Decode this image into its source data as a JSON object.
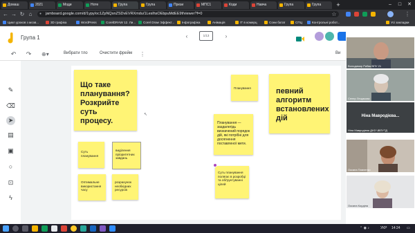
{
  "browser": {
    "tabs": [
      {
        "label": "Домаш",
        "color": "#f4b400"
      },
      {
        "label": "2021",
        "color": "#4285f4"
      },
      {
        "label": "Моди",
        "color": "#0f9d58"
      },
      {
        "label": "Ноте",
        "color": "#0f9d58"
      },
      {
        "label": "Група",
        "color": "#f4b400"
      },
      {
        "label": "Група",
        "color": "#f4b400"
      },
      {
        "label": "Прези",
        "color": "#4285f4"
      },
      {
        "label": "МПС1",
        "color": "#db4437"
      },
      {
        "label": "Коди",
        "color": "#db4437"
      },
      {
        "label": "Навча",
        "color": "#db4437"
      },
      {
        "label": "Група",
        "color": "#f4b400"
      },
      {
        "label": "Група",
        "color": "#f4b400"
      }
    ],
    "url": "jamboard.google.com/d/1ypy/oc1ZpNQsnZSDvEVRXmdu/1LeslhsOEbpuMdEE9f/viewer?f=0",
    "bookmarks": [
      {
        "label": "Цикл уроков з мозв...",
        "color": "#4285f4"
      },
      {
        "label": "3D графіка",
        "color": "#db4437"
      },
      {
        "label": "WordPress",
        "color": "#4285f4"
      },
      {
        "label": "CorelDRAW 12. Ли...",
        "color": "#0f9d58"
      },
      {
        "label": "Corel Draw Эффект...",
        "color": "#0f9d58"
      },
      {
        "label": "Інфографіка",
        "color": "#f4b400"
      },
      {
        "label": "Анімація",
        "color": "#f4b400"
      },
      {
        "label": "ІТ в комерц",
        "color": "#f4b400"
      },
      {
        "label": "Сони батаї",
        "color": "#f4b400"
      },
      {
        "label": "СПЦ",
        "color": "#f4b400"
      },
      {
        "label": "Контрольні робот...",
        "color": "#4285f4"
      }
    ],
    "other_bookmarks": "Усі закладки"
  },
  "jam": {
    "title": "Група 1",
    "frame_counter": "1/13",
    "set_background": "Вибрати тло",
    "clear_frame": "Очистити фрейм",
    "share_label": "Ви"
  },
  "notes": {
    "big_question": "Що таке планування? Розкрийте суть процесу.",
    "planning_word": "Планування",
    "definition_short": "певний алгоритм встановлених дій",
    "definition_long": "Планування — заздалегідь визначений порядок дій, які потрібні для досягнення поставленої мети.",
    "essence_planning": "Суть планування",
    "priority_tasks": "виділення пріоритетних завдань",
    "optimal_time": "Оптимальне використання часу",
    "resources": "розрахунок необхідних ресурсів",
    "essence_long": "Суть планування полягає в розробці та обґрунтуванні цілей"
  },
  "participants": [
    {
      "name": "Володимир Рибак ВПУ 21"
    },
    {
      "name": "Сепер Лещакова"
    },
    {
      "name": "Ніна Мавродієва..."
    },
    {
      "name": "Ніна Мавродієва ДНЗ ЧВПУТД"
    },
    {
      "name": "Оксана Павленко"
    },
    {
      "name": "Оксана Кордіна"
    }
  ],
  "taskbar": {
    "lang": "УКР",
    "time": "14:24"
  }
}
